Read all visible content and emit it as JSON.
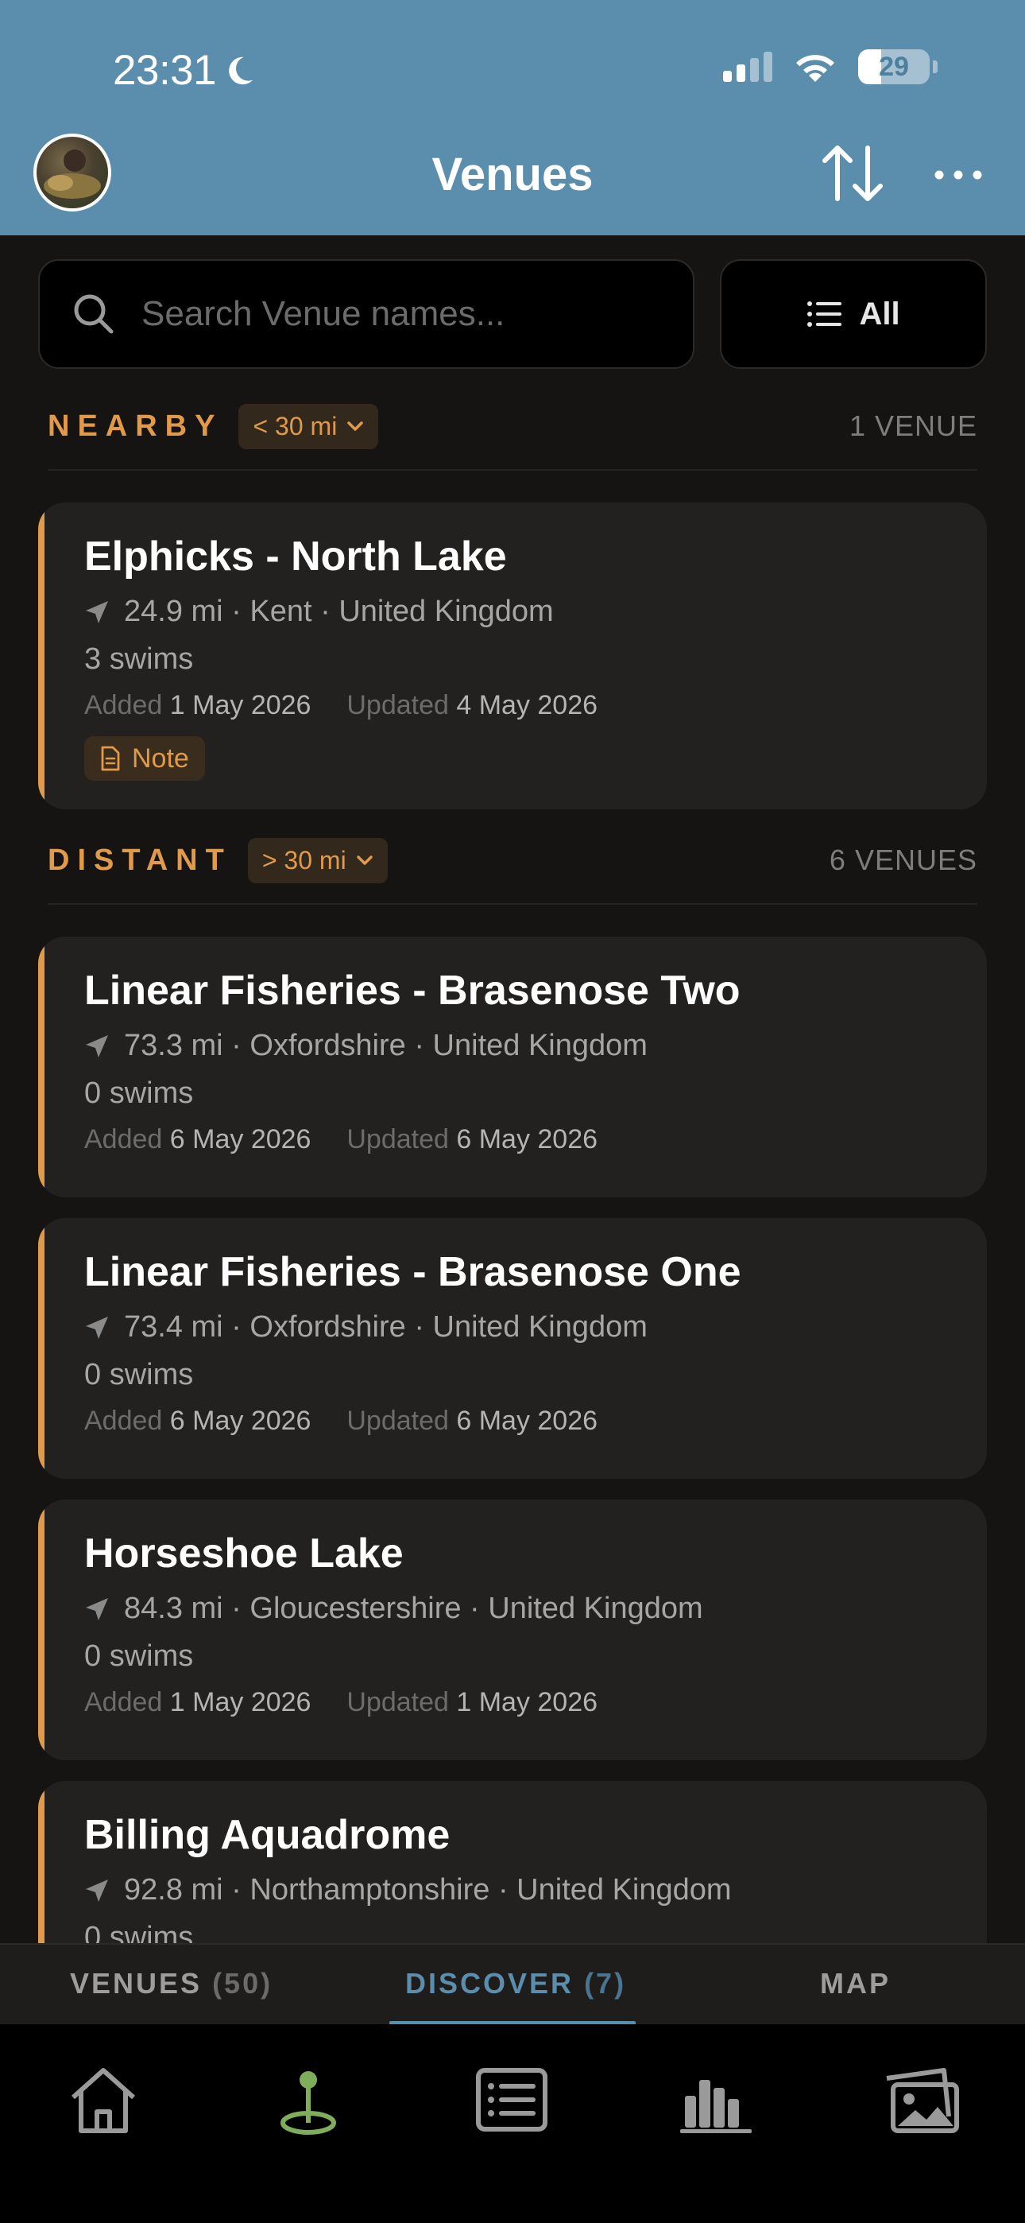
{
  "status_bar": {
    "time": "23:31",
    "battery": "29"
  },
  "header": {
    "title": "Venues"
  },
  "search": {
    "placeholder": "Search Venue names..."
  },
  "filter": {
    "label": "All"
  },
  "sections": {
    "nearby": {
      "label": "NEARBY",
      "range": "< 30 mi",
      "count": "1 VENUE"
    },
    "distant": {
      "label": "DISTANT",
      "range": "> 30 mi",
      "count": "6 VENUES"
    }
  },
  "venues": [
    {
      "name": "Elphicks - North Lake",
      "location": "24.9 mi · Kent · United Kingdom",
      "swims": "3 swims",
      "added_label": "Added",
      "added": "1 May 2026",
      "updated_label": "Updated",
      "updated": "4 May 2026",
      "note": "Note"
    },
    {
      "name": "Linear Fisheries - Brasenose Two",
      "location": "73.3 mi · Oxfordshire · United Kingdom",
      "swims": "0 swims",
      "added_label": "Added",
      "added": "6 May 2026",
      "updated_label": "Updated",
      "updated": "6 May 2026"
    },
    {
      "name": "Linear Fisheries - Brasenose One",
      "location": "73.4 mi · Oxfordshire · United Kingdom",
      "swims": "0 swims",
      "added_label": "Added",
      "added": "6 May 2026",
      "updated_label": "Updated",
      "updated": "6 May 2026"
    },
    {
      "name": "Horseshoe Lake",
      "location": "84.3 mi · Gloucestershire · United Kingdom",
      "swims": "0 swims",
      "added_label": "Added",
      "added": "1 May 2026",
      "updated_label": "Updated",
      "updated": "1 May 2026"
    },
    {
      "name": "Billing Aquadrome",
      "location": "92.8 mi · Northamptonshire · United Kingdom",
      "swims": "0 swims"
    }
  ],
  "segment_tabs": [
    {
      "label": "VENUES",
      "count": "(50)"
    },
    {
      "label": "DISCOVER",
      "count": "(7)"
    },
    {
      "label": "MAP",
      "count": ""
    }
  ],
  "tab_bar": [
    "home-icon",
    "location-pin-icon",
    "list-icon",
    "stats-icon",
    "gallery-icon"
  ],
  "colors": {
    "header": "#5b8dac",
    "accent": "#e19a49",
    "active_tab": "#5b8dac",
    "active_pin": "#7fae5a"
  }
}
